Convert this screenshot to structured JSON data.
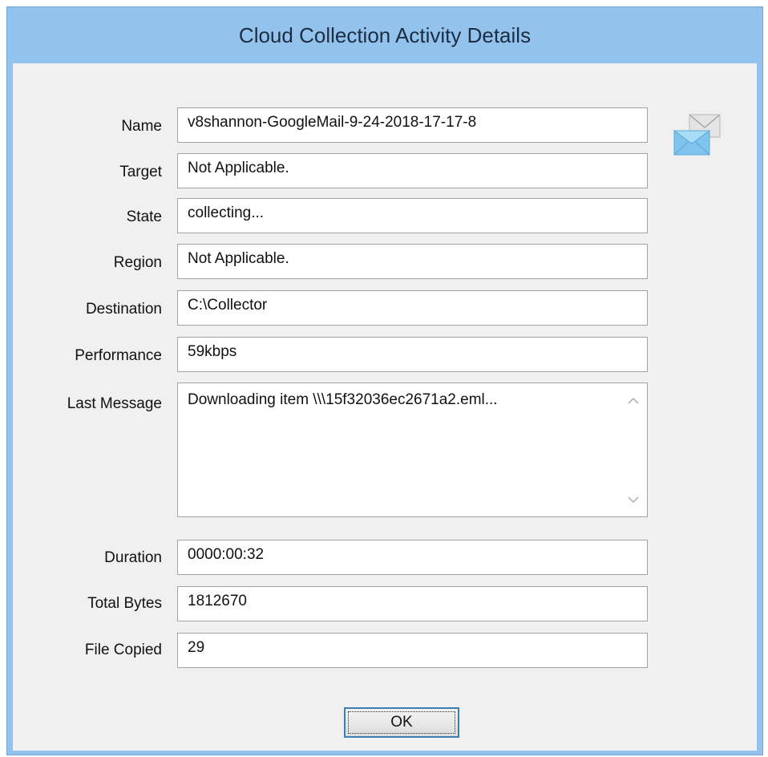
{
  "window": {
    "title": "Cloud Collection Activity Details"
  },
  "fields": {
    "name": {
      "label": "Name",
      "value": "v8shannon-GoogleMail-9-24-2018-17-17-8"
    },
    "target": {
      "label": "Target",
      "value": "Not Applicable."
    },
    "state": {
      "label": "State",
      "value": "collecting..."
    },
    "region": {
      "label": "Region",
      "value": "Not Applicable."
    },
    "destination": {
      "label": "Destination",
      "value": "C:\\Collector"
    },
    "performance": {
      "label": "Performance",
      "value": "59kbps"
    },
    "last_message": {
      "label": "Last Message",
      "value": "Downloading item \\\\\\15f32036ec2671a2.eml..."
    },
    "duration": {
      "label": "Duration",
      "value": "0000:00:32"
    },
    "total_bytes": {
      "label": "Total Bytes",
      "value": "1812670"
    },
    "file_copied": {
      "label": "File Copied",
      "value": "29"
    }
  },
  "buttons": {
    "ok_label": "OK"
  },
  "icons": {
    "mail": "mail-icon",
    "scroll_up": "chevron-up-icon",
    "scroll_down": "chevron-down-icon"
  },
  "colors": {
    "title_bar": "#93c3ec",
    "dialog_background": "#f0f0f0",
    "field_border": "#a3a3a3",
    "button_border": "#3c7fb1"
  }
}
